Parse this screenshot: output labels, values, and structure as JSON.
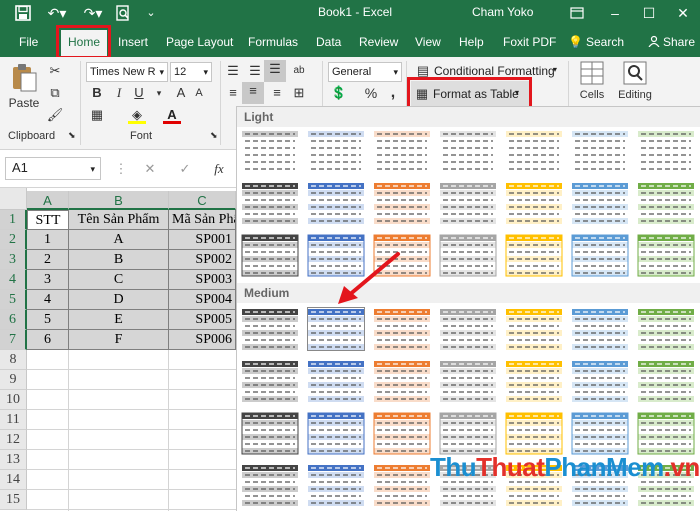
{
  "window": {
    "title": "Book1 - Excel",
    "user": "Cham Yoko"
  },
  "tabs": [
    "File",
    "Home",
    "Insert",
    "Page Layout",
    "Formulas",
    "Data",
    "Review",
    "View",
    "Help",
    "Foxit PDF",
    "Search",
    "Share"
  ],
  "ribbon": {
    "paste_label": "Paste",
    "clipboard_label": "Clipboard",
    "font_label": "Font",
    "font_name": "Times New R",
    "font_size": "12",
    "number_format": "General",
    "conditional_formatting": "Conditional Formatting",
    "format_as_table": "Format as Table",
    "cells_label": "Cells",
    "editing_label": "Editing",
    "percent_symbol": "%",
    "comma_symbol": ","
  },
  "formula_bar": {
    "name_box": "A1",
    "fx": "fx"
  },
  "gallery": {
    "light_label": "Light",
    "medium_label": "Medium"
  },
  "columns": [
    "A",
    "B",
    "C"
  ],
  "rows": [
    "1",
    "2",
    "3",
    "4",
    "5",
    "6",
    "7",
    "8",
    "9",
    "10",
    "11",
    "12",
    "13",
    "14",
    "15"
  ],
  "table": {
    "headers": [
      "STT",
      "Tên Sản Phẩm",
      "Mã Sản Phẩm"
    ],
    "data": [
      [
        "1",
        "A",
        "SP001"
      ],
      [
        "2",
        "B",
        "SP002"
      ],
      [
        "3",
        "C",
        "SP003"
      ],
      [
        "4",
        "D",
        "SP004"
      ],
      [
        "5",
        "E",
        "SP005"
      ],
      [
        "6",
        "F",
        "SP006"
      ]
    ]
  },
  "watermark": {
    "part1": "Thu",
    "part2": "Thuat",
    "part3": "PhanMem",
    "part4": ".vn"
  },
  "colors": {
    "excel_green": "#217346",
    "highlight_red": "#e3161d"
  }
}
